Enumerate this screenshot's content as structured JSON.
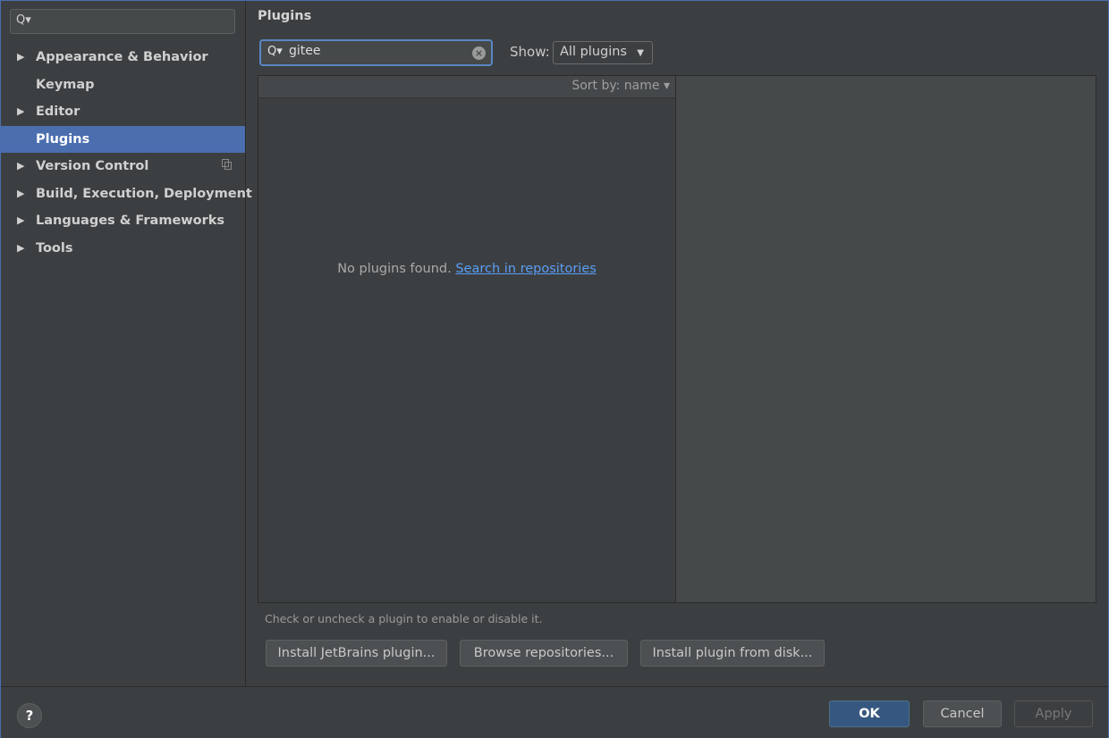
{
  "sidebar": {
    "search_icon": "search-icon",
    "items": [
      {
        "label": "Appearance & Behavior",
        "arrow": "▶"
      },
      {
        "label": "Keymap",
        "arrow": ""
      },
      {
        "label": "Editor",
        "arrow": "▶"
      },
      {
        "label": "Plugins",
        "arrow": ""
      },
      {
        "label": "Version Control",
        "arrow": "▶"
      },
      {
        "label": "Build, Execution, Deployment",
        "arrow": "▶"
      },
      {
        "label": "Languages & Frameworks",
        "arrow": "▶"
      },
      {
        "label": "Tools",
        "arrow": "▶"
      }
    ],
    "selected_index": 3
  },
  "main": {
    "title": "Plugins",
    "search": {
      "value": "gitee",
      "icon": "Q▾"
    },
    "show": {
      "label": "Show:",
      "selected": "All plugins"
    },
    "list": {
      "sort_label": "Sort by: name ▾",
      "empty_text": "No plugins found.",
      "empty_link": "Search in repositories"
    },
    "hint": "Check or uncheck a plugin to enable or disable it.",
    "buttons": {
      "install_jetbrains": "Install JetBrains plugin...",
      "browse": "Browse repositories...",
      "install_disk": "Install plugin from disk..."
    }
  },
  "footer": {
    "help": "?",
    "ok": "OK",
    "cancel": "Cancel",
    "apply": "Apply"
  },
  "colors": {
    "accent": "#4b6eaf",
    "link": "#589df6",
    "ok_button": "#365880"
  }
}
